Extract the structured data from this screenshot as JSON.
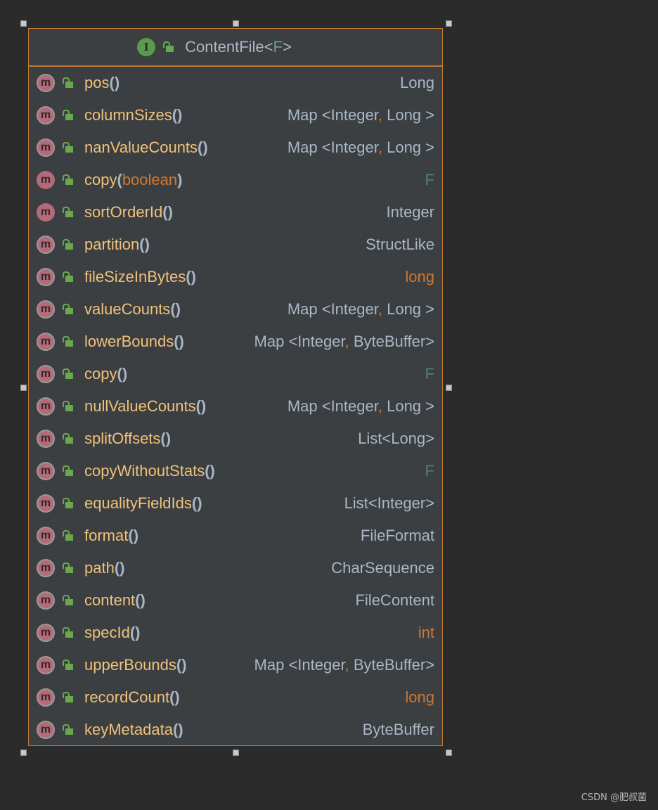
{
  "diagram": {
    "class_name": "ContentFile",
    "type_param": "F",
    "interface_badge": "I"
  },
  "methods": [
    {
      "name": "pos",
      "param": "",
      "ret_parts": [
        "Long"
      ],
      "ret_style": "normal",
      "icon_style": "ring"
    },
    {
      "name": "columnSizes",
      "param": "",
      "ret_parts": [
        "Map <Integer",
        ", ",
        "Long >"
      ],
      "ret_style": "normal",
      "icon_style": "ring"
    },
    {
      "name": "nanValueCounts",
      "param": "",
      "ret_parts": [
        "Map <Integer",
        ", ",
        "Long >"
      ],
      "ret_style": "normal",
      "icon_style": "ring"
    },
    {
      "name": "copy",
      "param": "boolean",
      "ret_parts": [
        "F"
      ],
      "ret_style": "typeparam",
      "icon_style": "plain"
    },
    {
      "name": "sortOrderId",
      "param": "",
      "ret_parts": [
        "Integer"
      ],
      "ret_style": "normal",
      "icon_style": "plain"
    },
    {
      "name": "partition",
      "param": "",
      "ret_parts": [
        "StructLike"
      ],
      "ret_style": "normal",
      "icon_style": "ring"
    },
    {
      "name": "fileSizeInBytes",
      "param": "",
      "ret_parts": [
        "long"
      ],
      "ret_style": "keyword",
      "icon_style": "ring"
    },
    {
      "name": "valueCounts",
      "param": "",
      "ret_parts": [
        "Map <Integer",
        ", ",
        "Long >"
      ],
      "ret_style": "normal",
      "icon_style": "ring"
    },
    {
      "name": "lowerBounds",
      "param": "",
      "ret_parts": [
        "Map <Integer",
        ", ",
        "ByteBuffer>"
      ],
      "ret_style": "normal",
      "icon_style": "ring"
    },
    {
      "name": "copy",
      "param": "",
      "ret_parts": [
        "F"
      ],
      "ret_style": "typeparam",
      "icon_style": "ring"
    },
    {
      "name": "nullValueCounts",
      "param": "",
      "ret_parts": [
        "Map <Integer",
        ", ",
        "Long >"
      ],
      "ret_style": "normal",
      "icon_style": "ring"
    },
    {
      "name": "splitOffsets",
      "param": "",
      "ret_parts": [
        "List<Long>"
      ],
      "ret_style": "normal",
      "icon_style": "ring"
    },
    {
      "name": "copyWithoutStats",
      "param": "",
      "ret_parts": [
        "F"
      ],
      "ret_style": "typeparam",
      "icon_style": "ring"
    },
    {
      "name": "equalityFieldIds",
      "param": "",
      "ret_parts": [
        "List<Integer>"
      ],
      "ret_style": "normal",
      "icon_style": "ring"
    },
    {
      "name": "format",
      "param": "",
      "ret_parts": [
        "FileFormat"
      ],
      "ret_style": "normal",
      "icon_style": "ring"
    },
    {
      "name": "path",
      "param": "",
      "ret_parts": [
        "CharSequence"
      ],
      "ret_style": "normal",
      "icon_style": "ring"
    },
    {
      "name": "content",
      "param": "",
      "ret_parts": [
        "FileContent"
      ],
      "ret_style": "normal",
      "icon_style": "ring"
    },
    {
      "name": "specId",
      "param": "",
      "ret_parts": [
        "int"
      ],
      "ret_style": "keyword",
      "icon_style": "ring"
    },
    {
      "name": "upperBounds",
      "param": "",
      "ret_parts": [
        "Map <Integer",
        ", ",
        "ByteBuffer>"
      ],
      "ret_style": "normal",
      "icon_style": "ring"
    },
    {
      "name": "recordCount",
      "param": "",
      "ret_parts": [
        "long"
      ],
      "ret_style": "keyword",
      "icon_style": "ring"
    },
    {
      "name": "keyMetadata",
      "param": "",
      "ret_parts": [
        "ByteBuffer"
      ],
      "ret_style": "normal",
      "icon_style": "ring"
    }
  ],
  "method_icon_letter": "m",
  "watermark": "CSDN @肥叔菌",
  "colors": {
    "background": "#2b2b2b",
    "panel": "#3c3f41",
    "border": "#c47a2d",
    "method_name": "#f0c27a",
    "keyword": "#cc7832",
    "type": "#a9b7c6",
    "type_param": "#4e7f72",
    "method_icon": "#b46a78",
    "interface_icon": "#5a9b4b"
  }
}
